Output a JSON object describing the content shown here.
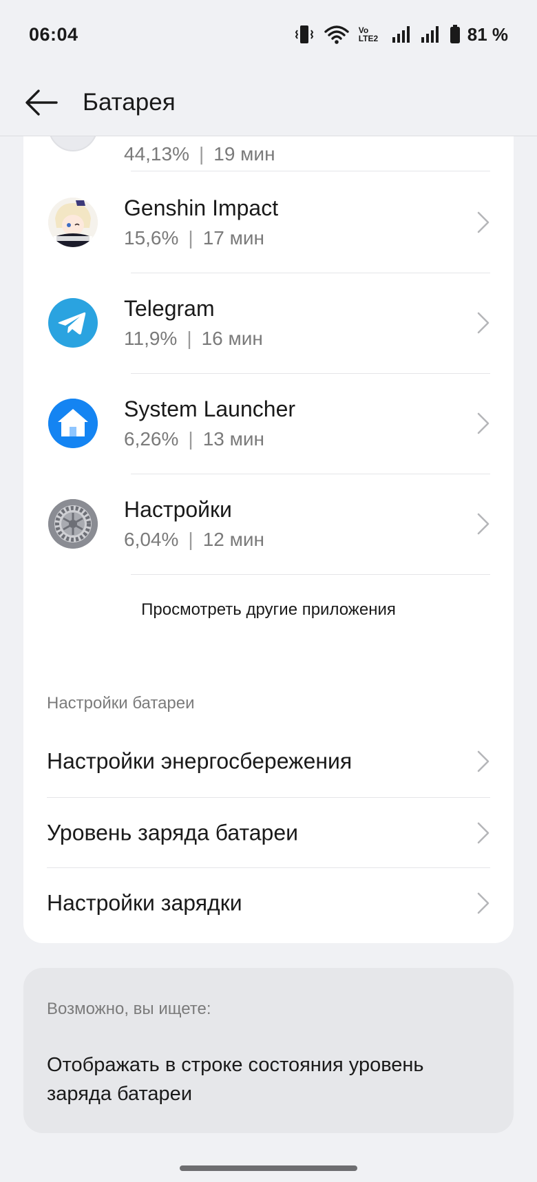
{
  "status_bar": {
    "time": "06:04",
    "network_label": "Vo LTE2",
    "battery_percent": "81 %"
  },
  "app_bar": {
    "title": "Батарея"
  },
  "apps": [
    {
      "name": "",
      "percent": "44,13%",
      "time": "19 мин",
      "icon": "app-icon-partial"
    },
    {
      "name": "Genshin Impact",
      "percent": "15,6%",
      "time": "17 мин",
      "icon": "genshin-impact-icon"
    },
    {
      "name": "Telegram",
      "percent": "11,9%",
      "time": "16 мин",
      "icon": "telegram-icon"
    },
    {
      "name": "System Launcher",
      "percent": "6,26%",
      "time": "13 мин",
      "icon": "system-launcher-icon"
    },
    {
      "name": "Настройки",
      "percent": "6,04%",
      "time": "12 мин",
      "icon": "settings-gear-icon"
    }
  ],
  "stats_separator": "|",
  "more_apps_label": "Просмотреть другие приложения",
  "battery_settings": {
    "section_label": "Настройки батареи",
    "items": [
      {
        "label": "Настройки энергосбережения"
      },
      {
        "label": "Уровень заряда батареи"
      },
      {
        "label": "Настройки зарядки"
      }
    ]
  },
  "suggestion": {
    "heading": "Возможно, вы ищете:",
    "text": "Отображать в строке состояния уровень заряда батареи"
  },
  "colors": {
    "background": "#f0f1f4",
    "card": "#ffffff",
    "telegram": "#2aa3e0",
    "launcher": "#1a86f0"
  }
}
